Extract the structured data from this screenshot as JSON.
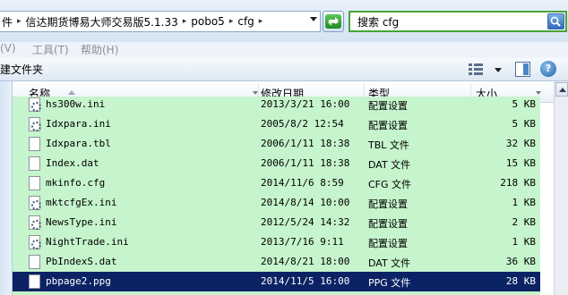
{
  "address_bar": {
    "crumbs": [
      "件",
      "信达期货博易大师交易版5.1.33",
      "pobo5",
      "cfg"
    ]
  },
  "search": {
    "text": "搜索 cfg"
  },
  "menu": {
    "items": [
      "(V)",
      "工具(T)",
      "帮助(H)"
    ]
  },
  "toolbar": {
    "new_folder_label": "建文件夹"
  },
  "columns": {
    "name": "名称",
    "date": "修改日期",
    "type": "类型",
    "size": "大小"
  },
  "files": [
    {
      "name": "hs300w.ini",
      "date": "2013/3/21 16:00",
      "type": "配置设置",
      "size": "5 KB",
      "icon": "config-file-icon",
      "selected": false
    },
    {
      "name": "Idxpara.ini",
      "date": "2005/8/2 12:54",
      "type": "配置设置",
      "size": "5 KB",
      "icon": "config-file-icon",
      "selected": false
    },
    {
      "name": "Idxpara.tbl",
      "date": "2006/1/11 18:38",
      "type": "TBL 文件",
      "size": "32 KB",
      "icon": "file-icon",
      "selected": false
    },
    {
      "name": "Index.dat",
      "date": "2006/1/11 18:38",
      "type": "DAT 文件",
      "size": "15 KB",
      "icon": "file-icon",
      "selected": false
    },
    {
      "name": "mkinfo.cfg",
      "date": "2014/11/6 8:59",
      "type": "CFG 文件",
      "size": "218 KB",
      "icon": "file-icon",
      "selected": false
    },
    {
      "name": "mktcfgEx.ini",
      "date": "2014/8/14 10:00",
      "type": "配置设置",
      "size": "1 KB",
      "icon": "config-file-icon",
      "selected": false
    },
    {
      "name": "NewsType.ini",
      "date": "2012/5/24 14:32",
      "type": "配置设置",
      "size": "2 KB",
      "icon": "config-file-icon",
      "selected": false
    },
    {
      "name": "NightTrade.ini",
      "date": "2013/7/16 9:11",
      "type": "配置设置",
      "size": "1 KB",
      "icon": "config-file-icon",
      "selected": false
    },
    {
      "name": "PbIndexS.dat",
      "date": "2014/8/21 18:00",
      "type": "DAT 文件",
      "size": "36 KB",
      "icon": "file-icon",
      "selected": false
    },
    {
      "name": "pbpage2.ppg",
      "date": "2014/11/5 16:00",
      "type": "PPG 文件",
      "size": "28 KB",
      "icon": "file-icon",
      "selected": true
    }
  ],
  "colors": {
    "row_bg": "#c6f4cc",
    "selected_bg": "#0b2364",
    "search_border": "#49a23a"
  }
}
